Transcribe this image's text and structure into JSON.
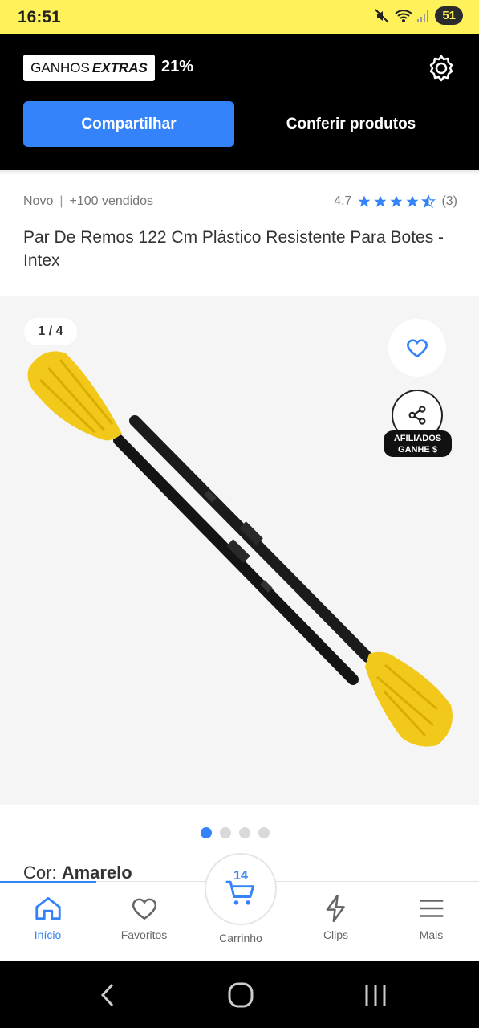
{
  "status_bar": {
    "time": "16:51",
    "battery": "51"
  },
  "affiliate_bar": {
    "badge_prefix": "GANHOS",
    "badge_suffix": "EXTRAS",
    "percent": "21%",
    "share_label": "Compartilhar",
    "check_products_label": "Conferir produtos"
  },
  "product": {
    "condition": "Novo",
    "sold": "+100 vendidos",
    "rating": "4.7",
    "rating_count": "(3)",
    "rating_value": 4.7,
    "title": "Par De Remos 122 Cm Plástico Resistente Para Botes - Intex"
  },
  "gallery": {
    "counter": "1 / 4",
    "affiliate_line1": "AFILIADOS",
    "affiliate_line2": "GANHE $",
    "dots_total": 4,
    "dots_active": 1
  },
  "variant": {
    "label": "Cor:",
    "value": "Amarelo"
  },
  "bottom_nav": {
    "items": [
      {
        "label": "Início",
        "icon": "home-icon"
      },
      {
        "label": "Favoritos",
        "icon": "heart-icon"
      },
      {
        "label": "Carrinho",
        "icon": "cart-icon"
      },
      {
        "label": "Clips",
        "icon": "lightning-icon"
      },
      {
        "label": "Mais",
        "icon": "menu-icon"
      }
    ],
    "cart_count": "14"
  },
  "colors": {
    "accent": "#3483fa",
    "brand_yellow": "#fff159"
  }
}
